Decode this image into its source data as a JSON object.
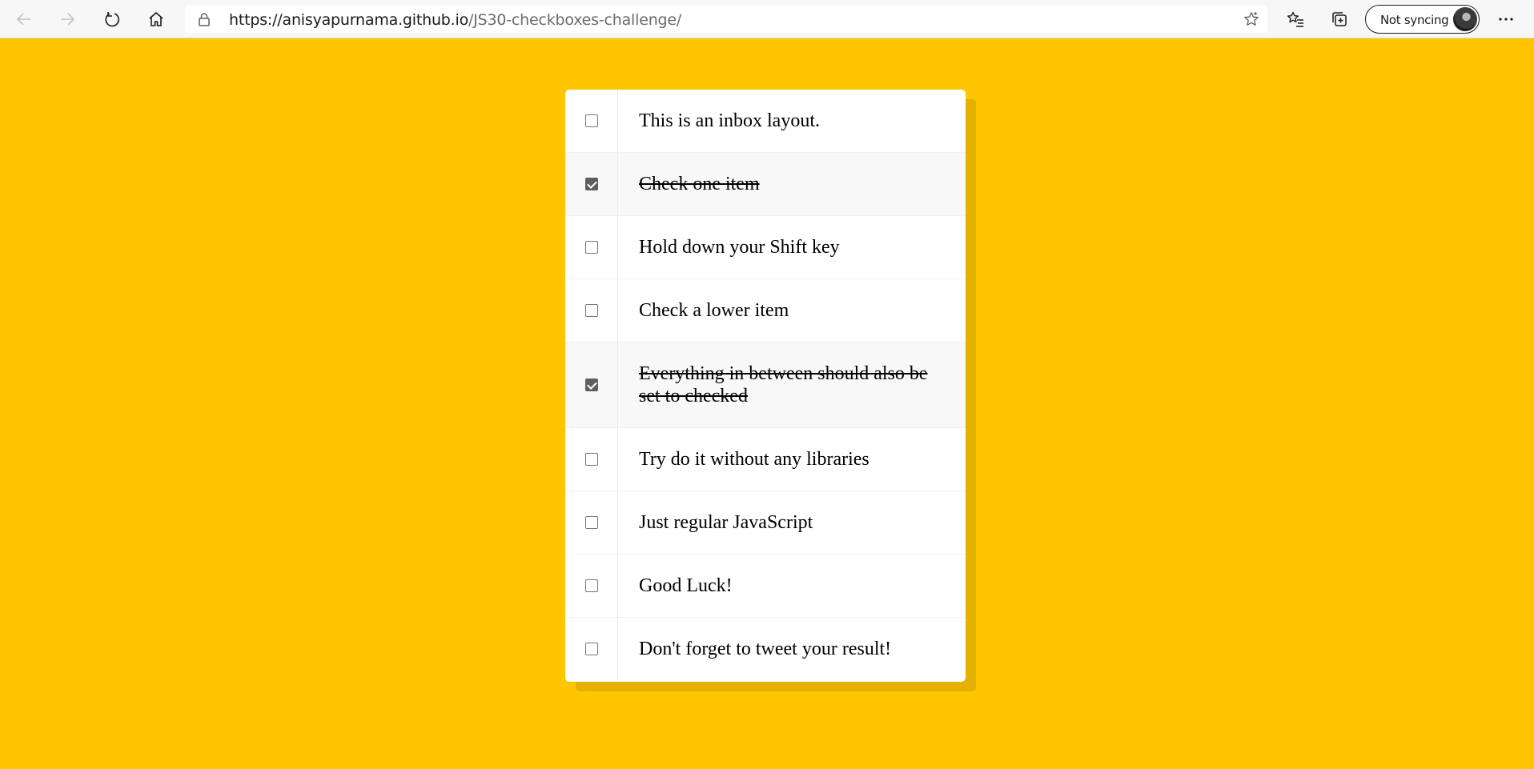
{
  "browser": {
    "url_host": "https://anisyapurnama.github.io",
    "url_path": "/JS30-checkboxes-challenge/",
    "sync_label": "Not syncing"
  },
  "inbox": {
    "items": [
      {
        "label": "This is an inbox layout.",
        "checked": false
      },
      {
        "label": "Check one item",
        "checked": true
      },
      {
        "label": "Hold down your Shift key",
        "checked": false
      },
      {
        "label": "Check a lower item",
        "checked": false
      },
      {
        "label": "Everything in between should also be set to checked",
        "checked": true
      },
      {
        "label": "Try do it without any libraries",
        "checked": false
      },
      {
        "label": "Just regular JavaScript",
        "checked": false
      },
      {
        "label": "Good Luck!",
        "checked": false
      },
      {
        "label": "Don't forget to tweet your result!",
        "checked": false
      }
    ]
  },
  "colors": {
    "page_background": "#ffc600",
    "card_background": "#ffffff",
    "checked_row_background": "#f8f8f8"
  }
}
